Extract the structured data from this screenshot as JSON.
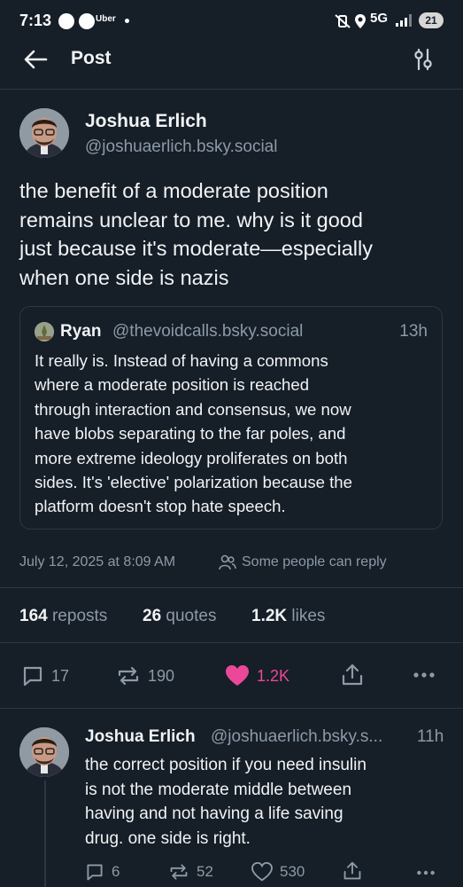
{
  "status_bar": {
    "time": "7:13",
    "app_label": "Uber",
    "network": "5G",
    "battery": "21"
  },
  "header": {
    "title": "Post"
  },
  "post": {
    "author_name": "Joshua Erlich",
    "author_handle": "@joshuaerlich.bsky.social",
    "text_lines": [
      "the benefit of a moderate position",
      "remains unclear to me. why is it good",
      "just because it's moderate—especially",
      "when one side is nazis"
    ],
    "quote": {
      "author_name": "Ryan",
      "author_handle": "@thevoidcalls.bsky.social",
      "time": "13h",
      "text_lines": [
        "It really is. Instead of having a commons",
        "where a moderate position is reached",
        "through interaction and consensus, we now",
        "have blobs separating to the far poles, and",
        "more extreme ideology proliferates on both",
        "sides. It's 'elective' polarization because the",
        "platform doesn't stop hate speech."
      ]
    },
    "date": "July 12, 2025 at 8:09 AM",
    "reply_setting": "Some people can reply",
    "stats": {
      "reposts_count": "164",
      "reposts_label": "reposts",
      "quotes_count": "26",
      "quotes_label": "quotes",
      "likes_count": "1.2K",
      "likes_label": "likes"
    },
    "actions": {
      "replies": "17",
      "reposts": "190",
      "likes": "1.2K"
    },
    "like_color": "#ec4899"
  },
  "reply": {
    "author_name": "Joshua Erlich",
    "author_handle": "@joshuaerlich.bsky.s...",
    "time": "11h",
    "text_lines": [
      "the correct position if you need insulin",
      "is not the moderate middle between",
      "having and not having a life saving",
      "drug. one side is right."
    ],
    "actions": {
      "replies": "6",
      "reposts": "52",
      "likes": "530"
    }
  }
}
